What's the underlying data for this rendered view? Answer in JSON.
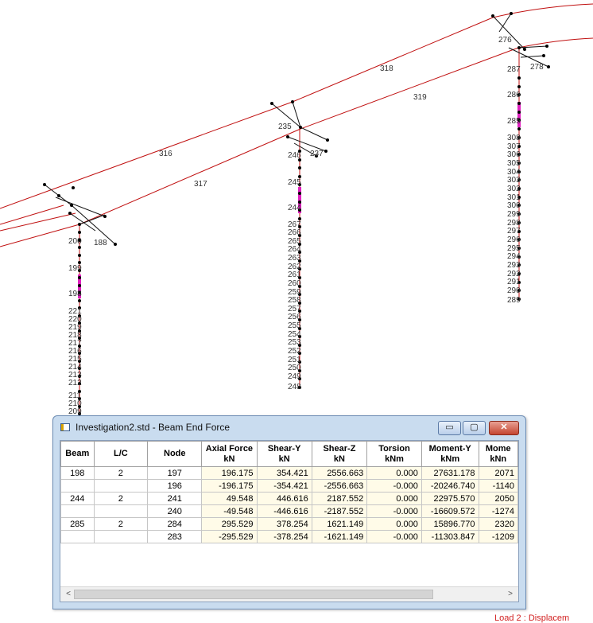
{
  "model": {
    "colors": {
      "member": "#c01010",
      "highlight": "#e020c0",
      "node": "#000000"
    },
    "beam_labels": [
      "316",
      "317",
      "318",
      "319"
    ],
    "node_labels": {
      "left": [
        "199",
        "198",
        "221",
        "220",
        "219",
        "218",
        "217",
        "216",
        "215",
        "214",
        "213",
        "212",
        "211",
        "210",
        "209",
        "200",
        "188"
      ],
      "middle": [
        "235",
        "245",
        "244",
        "246",
        "237",
        "267",
        "266",
        "265",
        "264",
        "263",
        "262",
        "261",
        "260",
        "259",
        "258",
        "257",
        "256",
        "255",
        "254",
        "253",
        "252",
        "251",
        "250",
        "249",
        "248"
      ],
      "right": [
        "276",
        "287",
        "286",
        "285",
        "278",
        "308",
        "307",
        "306",
        "305",
        "304",
        "303",
        "302",
        "301",
        "300",
        "299",
        "298",
        "297",
        "296",
        "295",
        "294",
        "293",
        "292",
        "291",
        "290",
        "289"
      ]
    }
  },
  "window": {
    "title": "Investigation2.std - Beam End Force",
    "min_symbol": "▭",
    "max_symbol": "▢",
    "close_symbol": "✕",
    "columns": [
      {
        "name": "Beam",
        "unit": ""
      },
      {
        "name": "L/C",
        "unit": ""
      },
      {
        "name": "Node",
        "unit": ""
      },
      {
        "name": "Axial Force",
        "unit": "kN"
      },
      {
        "name": "Shear-Y",
        "unit": "kN"
      },
      {
        "name": "Shear-Z",
        "unit": "kN"
      },
      {
        "name": "Torsion",
        "unit": "kNm"
      },
      {
        "name": "Moment-Y",
        "unit": "kNm"
      },
      {
        "name": "Mome",
        "unit": "kNn"
      }
    ],
    "rows": [
      [
        "198",
        "2",
        "197",
        "196.175",
        "354.421",
        "2556.663",
        "0.000",
        "27631.178",
        "2071"
      ],
      [
        "",
        "",
        "196",
        "-196.175",
        "-354.421",
        "-2556.663",
        "-0.000",
        "-20246.740",
        "-1140"
      ],
      [
        "244",
        "2",
        "241",
        "49.548",
        "446.616",
        "2187.552",
        "0.000",
        "22975.570",
        "2050"
      ],
      [
        "",
        "",
        "240",
        "-49.548",
        "-446.616",
        "-2187.552",
        "-0.000",
        "-16609.572",
        "-1274"
      ],
      [
        "285",
        "2",
        "284",
        "295.529",
        "378.254",
        "1621.149",
        "0.000",
        "15896.770",
        "2320"
      ],
      [
        "",
        "",
        "283",
        "-295.529",
        "-378.254",
        "-1621.149",
        "-0.000",
        "-11303.847",
        "-1209"
      ]
    ],
    "scroll_left": "<",
    "scroll_right": ">"
  },
  "status": {
    "load_label": "Load 2 : Displacem"
  }
}
